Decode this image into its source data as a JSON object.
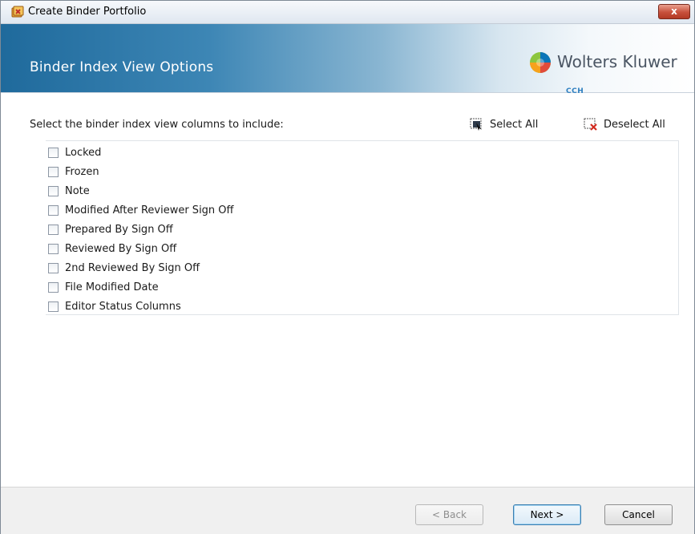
{
  "window": {
    "title": "Create Binder Portfolio",
    "close_label": "x"
  },
  "banner": {
    "title": "Binder Index View Options",
    "brand": "Wolters Kluwer",
    "brand_sub": "CCH"
  },
  "content": {
    "prompt": "Select the binder index view columns to include:",
    "select_all": "Select All",
    "deselect_all": "Deselect All",
    "columns": [
      {
        "label": "Locked",
        "checked": false
      },
      {
        "label": "Frozen",
        "checked": false
      },
      {
        "label": "Note",
        "checked": false
      },
      {
        "label": "Modified After Reviewer Sign Off",
        "checked": false
      },
      {
        "label": "Prepared By Sign Off",
        "checked": false
      },
      {
        "label": "Reviewed By Sign Off",
        "checked": false
      },
      {
        "label": "2nd Reviewed By Sign Off",
        "checked": false
      },
      {
        "label": "File Modified Date",
        "checked": false
      },
      {
        "label": "Editor Status Columns",
        "checked": false
      }
    ]
  },
  "footer": {
    "back": "< Back",
    "next": "Next >",
    "cancel": "Cancel"
  },
  "colors": {
    "banner_start": "#1f6a9c",
    "close": "#c7503b",
    "brand_sub": "#2e7fc0"
  }
}
